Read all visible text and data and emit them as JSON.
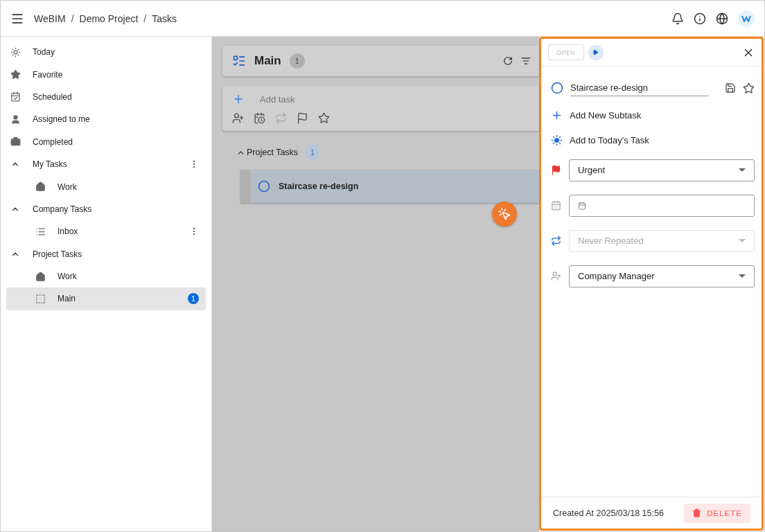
{
  "breadcrumb": {
    "separator": "/",
    "items": [
      "WeBIM",
      "Demo Project",
      "Tasks"
    ]
  },
  "sidebar": {
    "items": [
      {
        "kind": "link",
        "label": "Today",
        "selected": false
      },
      {
        "kind": "link",
        "label": "Favorite",
        "selected": false
      },
      {
        "kind": "link",
        "label": "Scheduled",
        "selected": false
      },
      {
        "kind": "link",
        "label": "Assigned to me",
        "selected": false
      },
      {
        "kind": "link",
        "label": "Completed",
        "selected": false
      },
      {
        "kind": "group",
        "label": "My Tasks",
        "expanded": true,
        "has_menu": true,
        "children": [
          {
            "label": "Work",
            "selected": false,
            "has_menu": false
          }
        ]
      },
      {
        "kind": "group",
        "label": "Company Tasks",
        "expanded": true,
        "has_menu": false,
        "children": [
          {
            "label": "Inbox",
            "selected": false,
            "has_menu": true
          }
        ]
      },
      {
        "kind": "group",
        "label": "Project Tasks",
        "expanded": true,
        "has_menu": false,
        "children": [
          {
            "label": "Work",
            "selected": false,
            "has_menu": false
          },
          {
            "label": "Main",
            "selected": true,
            "has_menu": false,
            "badge": "1"
          }
        ]
      }
    ]
  },
  "list": {
    "title": "Main",
    "count": "1",
    "add_placeholder": "Add task",
    "sections": [
      {
        "title": "Project Tasks",
        "count": "1",
        "expanded": true,
        "tasks": [
          {
            "title": "Staircase re-design",
            "completed": false,
            "selected": true
          }
        ]
      }
    ]
  },
  "detail": {
    "status": "OPEN",
    "status_disabled": true,
    "title": "Staircase re-design",
    "completed": false,
    "favorite": false,
    "actions": [
      {
        "kind": "subtask",
        "label": "Add New Subtask"
      },
      {
        "kind": "today",
        "label": "Add to Today's Task"
      }
    ],
    "fields": [
      {
        "kind": "priority",
        "value": "Urgent",
        "disabled": false
      },
      {
        "kind": "date",
        "disabled": false
      },
      {
        "kind": "repeat",
        "value": "Never Repeated",
        "disabled": true
      },
      {
        "kind": "assignee",
        "value": "Company Manager",
        "disabled": false
      }
    ],
    "created": "Created At 2025/03/18 15:56",
    "delete": "DELETE"
  }
}
